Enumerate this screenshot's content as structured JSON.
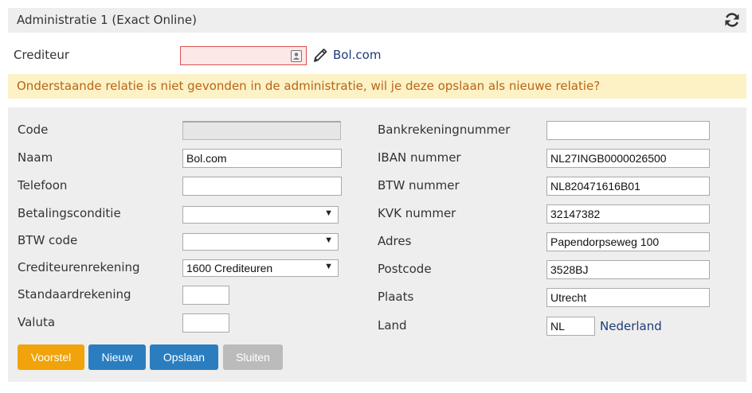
{
  "header": {
    "title": "Administratie 1 (Exact Online)",
    "refresh_icon": "refresh-icon"
  },
  "crediteur": {
    "label": "Crediteur",
    "value": "",
    "link": "Bol.com",
    "contact_icon": "contact-card-icon",
    "edit_icon": "pencil-icon"
  },
  "warning": {
    "text": "Onderstaande relatie is niet gevonden in de administratie, wil je deze opslaan als nieuwe relatie?"
  },
  "form_left": {
    "code": {
      "label": "Code",
      "value": ""
    },
    "naam": {
      "label": "Naam",
      "value": "Bol.com"
    },
    "telefoon": {
      "label": "Telefoon",
      "value": ""
    },
    "betalingsconditie": {
      "label": "Betalingsconditie",
      "value": ""
    },
    "btw_code": {
      "label": "BTW code",
      "value": ""
    },
    "crediteurenrekening": {
      "label": "Crediteurenrekening",
      "value": "1600 Crediteuren"
    },
    "standaardrekening": {
      "label": "Standaardrekening",
      "value": ""
    },
    "valuta": {
      "label": "Valuta",
      "value": ""
    }
  },
  "form_right": {
    "bankrekeningnummer": {
      "label": "Bankrekeningnummer",
      "value": ""
    },
    "iban": {
      "label": "IBAN nummer",
      "value": "NL27INGB0000026500"
    },
    "btw_nummer": {
      "label": "BTW nummer",
      "value": "NL820471616B01"
    },
    "kvk": {
      "label": "KVK nummer",
      "value": "32147382"
    },
    "adres": {
      "label": "Adres",
      "value": "Papendorpseweg 100"
    },
    "postcode": {
      "label": "Postcode",
      "value": "3528BJ"
    },
    "plaats": {
      "label": "Plaats",
      "value": "Utrecht"
    },
    "land": {
      "label": "Land",
      "value": "NL",
      "name": "Nederland"
    }
  },
  "buttons": {
    "voorstel": "Voorstel",
    "nieuw": "Nieuw",
    "opslaan": "Opslaan",
    "sluiten": "Sluiten"
  },
  "colors": {
    "voorstel": "#f0a30a",
    "primary": "#2a7ec0",
    "disabled": "#bbbbbb",
    "warning_bg": "#fcf2c5",
    "warning_text": "#b8651a",
    "error_border": "#d9534f",
    "link": "#1e3a78"
  }
}
